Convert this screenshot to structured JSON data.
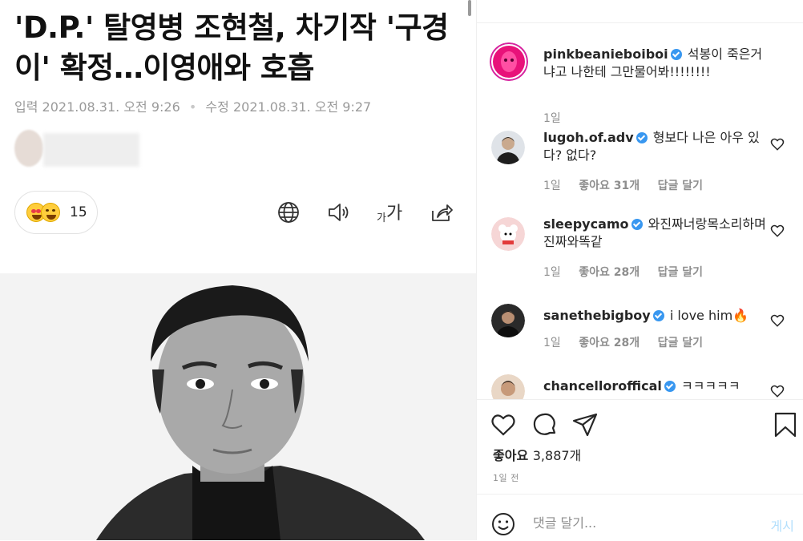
{
  "article": {
    "headline": "'D.P.' 탈영병 조현철, 차기작 '구경이' 확정…이영애와 호흡",
    "input_label": "입력",
    "input_date": "2021.08.31. 오전 9:26",
    "modified_label": "수정",
    "modified_date": "2021.08.31. 오전 9:27",
    "reaction_count": "15"
  },
  "instagram": {
    "comments": [
      {
        "user": "pinkbeanieboiboi",
        "text": "석봉이 죽은거냐고 나한테 그만물어봐!!!!!!!!",
        "time": "1일",
        "likes": "",
        "reply": ""
      },
      {
        "user": "lugoh.of.adv",
        "text": "형보다 나은 아우 있다? 없다?",
        "time": "1일",
        "likes": "좋아요 31개",
        "reply": "답글 달기"
      },
      {
        "user": "sleepycamo",
        "text": "와진짜너랑목소리하며진짜와똑같",
        "time": "1일",
        "likes": "좋아요 28개",
        "reply": "답글 달기"
      },
      {
        "user": "sanethebigboy",
        "text": "i love him🔥",
        "time": "1일",
        "likes": "좋아요 28개",
        "reply": "답글 달기"
      },
      {
        "user": "chancelloroffical",
        "text": "ㅋㅋㅋㅋㅋ",
        "time": "",
        "likes": "",
        "reply": ""
      }
    ],
    "likes_label": "좋아요",
    "likes_count": "3,887개",
    "time_ago": "1일 전",
    "comment_placeholder": "댓글 달기...",
    "post_label": "게시"
  },
  "colors": {
    "verified": "#3897f0",
    "post_button": "#b2dffc",
    "meta_text": "#8e8e8e"
  },
  "icons": [
    "globe-icon",
    "speaker-icon",
    "share-icon",
    "heart-icon",
    "comment-icon",
    "send-icon",
    "bookmark-icon",
    "smile-icon",
    "verified-icon"
  ]
}
